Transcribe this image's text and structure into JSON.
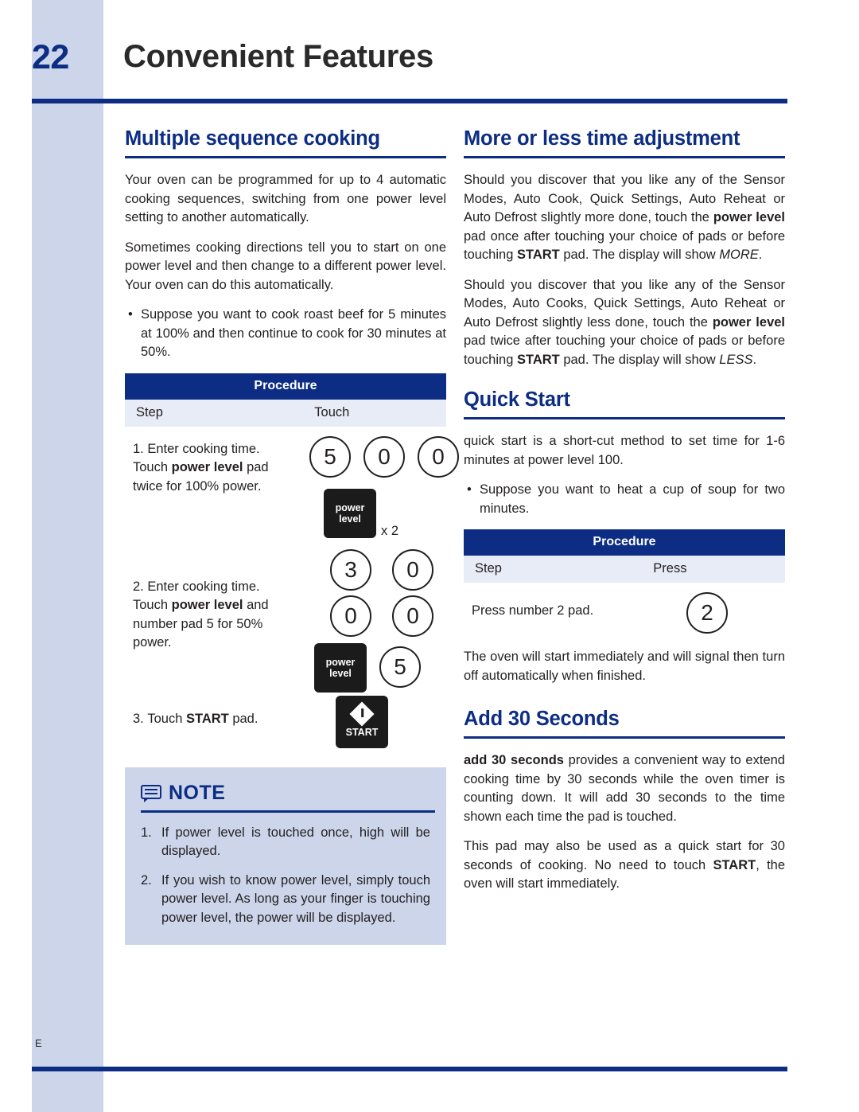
{
  "header": {
    "page_number": "22",
    "chapter_title": "Convenient Features"
  },
  "footer": {
    "mark": "E"
  },
  "left_column": {
    "section1": {
      "heading": "Multiple sequence cooking",
      "paragraphs": [
        "Your oven can be programmed for up to 4 automatic cooking sequences, switching from one power level setting to another automatically.",
        "Sometimes cooking directions tell you to start on one power level and then change to a different power level. Your oven can do this automatically."
      ],
      "bullet": "Suppose you want to cook roast beef for 5 minutes at 100% and then continue to cook for 30 minutes at 50%.",
      "procedure": {
        "title": "Procedure",
        "col1": "Step",
        "col2": "Touch",
        "steps": [
          {
            "number": "1.",
            "text_plain": "Enter cooking time. Touch power level pad twice for 100% power.",
            "keys": [
              "5",
              "0",
              "0"
            ],
            "pad_label_line1": "power",
            "pad_label_line2": "level",
            "multiplier": "x 2"
          },
          {
            "number": "2.",
            "text_plain": "Enter cooking time. Touch power level and number pad 5 for 50% power.",
            "keys_row1": [
              "3",
              "0"
            ],
            "keys_row2": [
              "0",
              "0"
            ],
            "pad_label_line1": "power",
            "pad_label_line2": "level",
            "key_after_pad": "5"
          },
          {
            "number": "3.",
            "text_plain": "Touch START pad.",
            "start_label": "START"
          }
        ]
      }
    },
    "note": {
      "title": "NOTE",
      "items": [
        {
          "number": "1.",
          "text": "If power level is touched once, high will be displayed."
        },
        {
          "number": "2.",
          "text": "If you wish to know power level, simply touch power level. As long as your finger is touching power level, the power will be displayed."
        }
      ]
    }
  },
  "right_column": {
    "section1": {
      "heading": "More or less time adjustment",
      "para1_parts": {
        "a": "Should you discover that you like any of the Sensor Modes, Auto Cook, Quick Settings, Auto Reheat or Auto Defrost slightly more done, touch the ",
        "b_bold": "power level",
        "c": " pad once after touching your choice of pads or before touching ",
        "d_bold": "START",
        "e": " pad. The display will show ",
        "f_italic": "MORE",
        "g": "."
      },
      "para2_parts": {
        "a": "Should you discover that you like any of the Sensor Modes, Auto Cooks, Quick Settings, Auto Reheat or Auto Defrost slightly less done, touch the ",
        "b_bold": "power level",
        "c": " pad twice after touching your choice of pads or before touching ",
        "d_bold": "START",
        "e": " pad. The display will show ",
        "f_italic": "LESS",
        "g": "."
      }
    },
    "section2": {
      "heading": "Quick Start",
      "para1": "quick start is a short-cut method to set time for 1-6 minutes at power level 100.",
      "bullet": "Suppose you want to heat a cup of soup for two minutes.",
      "procedure": {
        "title": "Procedure",
        "col1": "Step",
        "col2": "Press",
        "step_text": "Press number 2 pad.",
        "key": "2"
      },
      "para2": "The oven will start immediately and will signal then turn off automatically when finished."
    },
    "section3": {
      "heading": "Add 30 Seconds",
      "para1_parts": {
        "a_bold": "add 30 seconds",
        "b": " provides a convenient way to extend cooking time by 30 seconds while the oven timer is counting down. It will add 30 seconds to the time shown each time the pad is touched."
      },
      "para2_parts": {
        "a": "This pad may also be used as a quick start for 30 seconds of cooking. No need to touch ",
        "b_bold": "START",
        "c": ", the oven will start immediately."
      }
    }
  },
  "colors": {
    "brand_blue": "#0c2d83",
    "light_blue": "#ccd5ea",
    "table_sub": "#e8ecf6"
  }
}
